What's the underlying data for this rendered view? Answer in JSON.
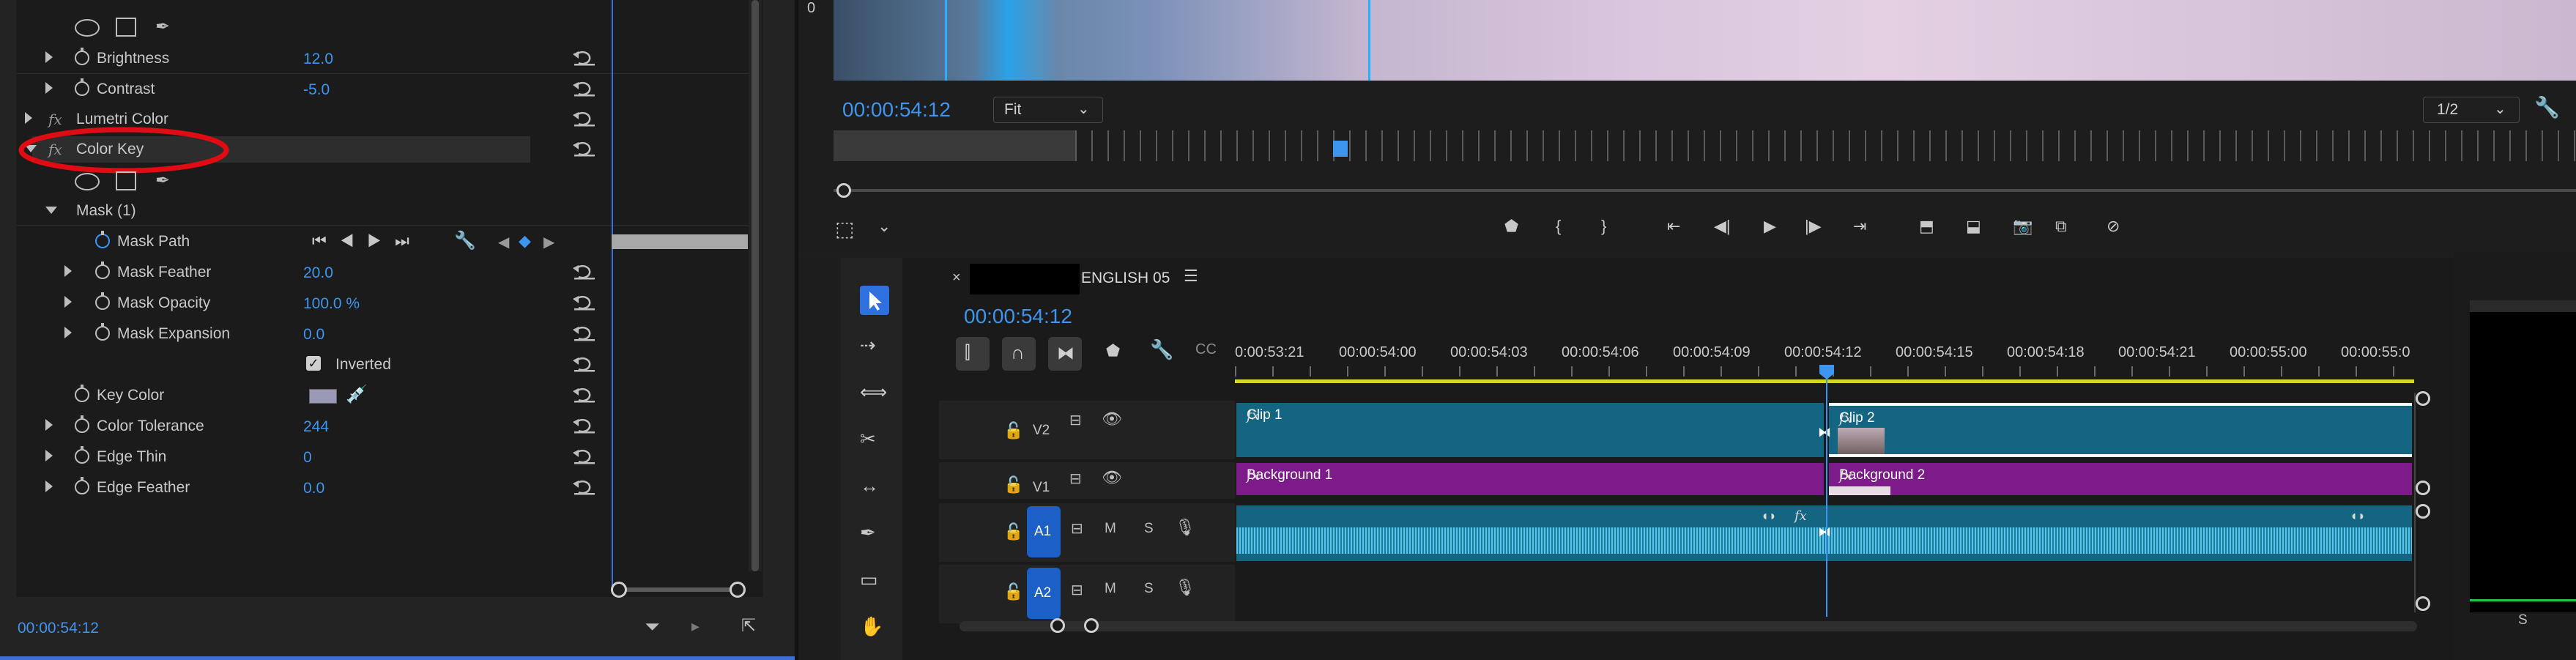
{
  "effect_controls": {
    "items": [
      {
        "label": "Brightness",
        "value": "12.0"
      },
      {
        "label": "Contrast",
        "value": "-5.0"
      },
      {
        "label": "Lumetri Color"
      },
      {
        "label": "Color Key"
      },
      {
        "label": "Mask (1)"
      },
      {
        "label": "Mask Path"
      },
      {
        "label": "Mask Feather",
        "value": "20.0"
      },
      {
        "label": "Mask Opacity",
        "value": "100.0 %"
      },
      {
        "label": "Mask Expansion",
        "value": "0.0"
      },
      {
        "label": "Inverted"
      },
      {
        "label": "Key Color"
      },
      {
        "label": "Color Tolerance",
        "value": "244"
      },
      {
        "label": "Edge Thin",
        "value": "0"
      },
      {
        "label": "Edge Feather",
        "value": "0.0"
      }
    ],
    "fx_symbol": "fx",
    "timecode": "00:00:54:12",
    "key_color": "#9a9ab6"
  },
  "program_monitor": {
    "timecode": "00:00:54:12",
    "fit_label": "Fit",
    "resolution": "1/2"
  },
  "timeline": {
    "sequence_name": "ENGLISH 05",
    "timecode": "00:00:54:12",
    "ruler": [
      "0:00:53:21",
      "00:00:54:00",
      "00:00:54:03",
      "00:00:54:06",
      "00:00:54:09",
      "00:00:54:12",
      "00:00:54:15",
      "00:00:54:18",
      "00:00:54:21",
      "00:00:55:00",
      "00:00:55:0"
    ],
    "tracks": {
      "v2": "V2",
      "v1": "V1",
      "a1": "A1",
      "a2": "A2",
      "m": "M",
      "s": "S"
    },
    "clips": {
      "clip1": "Clip 1",
      "clip2": "Clip 2",
      "bg1": "Background 1",
      "bg2": "Background 2",
      "fx": "fx"
    }
  },
  "meter": {
    "label": "S"
  }
}
